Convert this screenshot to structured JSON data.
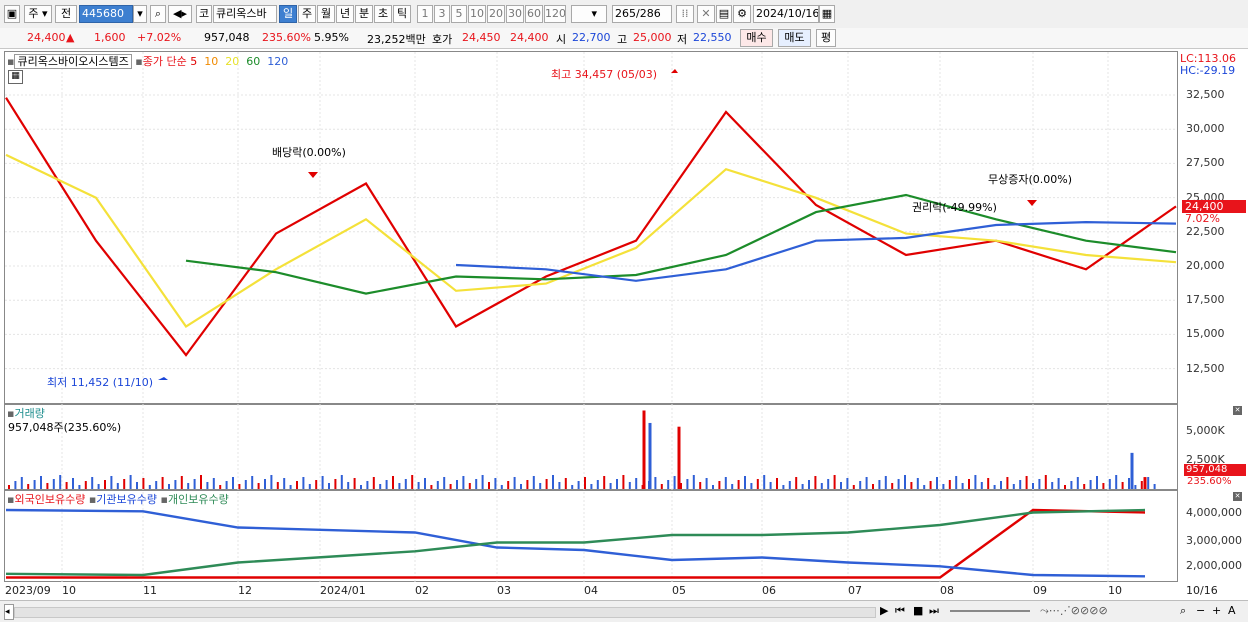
{
  "toolbar": {
    "market": "주",
    "range": "전",
    "code": "445680",
    "name_btn": "코",
    "name": "큐리옥스바",
    "periods": [
      "일",
      "주",
      "월",
      "년",
      "분",
      "초",
      "틱"
    ],
    "active_period": "일",
    "intervals": [
      "1",
      "3",
      "5",
      "10",
      "20",
      "30",
      "60",
      "120"
    ],
    "count": "265",
    "total": "/286",
    "date": "2024/10/16"
  },
  "quote": {
    "price": "24,400",
    "up_symbol": "▲",
    "change": "1,600",
    "change_pct": "+7.02%",
    "volume": "957,048",
    "volume_ratio": "235.60%",
    "turnover": "5.95%",
    "amount": "23,252백만",
    "ask_label": "호가",
    "ask_price": "24,450",
    "bid_price": "24,400",
    "open_label": "시",
    "open": "22,700",
    "high_label": "고",
    "high": "25,000",
    "low_label": "저",
    "low": "22,550",
    "buy_btn": "매수",
    "sell_btn": "매도",
    "eval_btn": "평"
  },
  "legend": {
    "stock": "큐리옥스바이오시스템즈",
    "ma_label": "종가 단순",
    "ma_periods": [
      "5",
      "10",
      "20",
      "60",
      "120"
    ],
    "ma_colors": [
      "#e00000",
      "#f08a00",
      "#e7e12a",
      "#1c8c2a",
      "#2f5fd6"
    ],
    "lc": "LC:113.06",
    "hc": "HC:-29.19"
  },
  "annotations": {
    "high": "최고 34,457 (05/03)",
    "low": "최저 11,452 (11/10)",
    "dividend": "배당락(0.00%)",
    "rights": "권리락(-49.99%)",
    "bonus": "무상증자(0.00%)"
  },
  "price_axis": [
    "32,500",
    "30,000",
    "27,500",
    "25,000",
    "22,500",
    "20,000",
    "17,500",
    "15,000",
    "12,500"
  ],
  "current_price_tag": "24,400",
  "current_pct_tag": "7.02%",
  "volume_panel": {
    "title": "거래량",
    "value": "957,048주(235.60%)",
    "axis": [
      "5,000K",
      "2,500K"
    ],
    "tag": "957,048",
    "tag_pct": "235.60%"
  },
  "holding_panel": {
    "series": [
      "외국인보유수량",
      "기관보유수량",
      "개인보유수량"
    ],
    "colors": [
      "#e00000",
      "#2f5fd6",
      "#2e8b57"
    ],
    "axis": [
      "4,000,000",
      "3,000,000",
      "2,000,000"
    ]
  },
  "x_axis": [
    "2023/09",
    "10",
    "11",
    "12",
    "2024/01",
    "02",
    "03",
    "04",
    "05",
    "06",
    "07",
    "08",
    "09",
    "10",
    "10/16"
  ],
  "chart_data": [
    {
      "type": "line",
      "title": "큐리옥스바이오시스템즈 일봉",
      "x": [
        "2023-09",
        "2023-10",
        "2023-11",
        "2023-12",
        "2024-01",
        "2024-02",
        "2024-03",
        "2024-04",
        "2024-05",
        "2024-06",
        "2024-07",
        "2024-08",
        "2024-09",
        "2024-10"
      ],
      "series": [
        {
          "name": "종가",
          "values": [
            32000,
            22000,
            14000,
            22500,
            26000,
            16000,
            19500,
            22000,
            31000,
            24500,
            21000,
            22000,
            20000,
            24400
          ]
        },
        {
          "name": "20",
          "values": [
            28000,
            25000,
            16000,
            20000,
            23500,
            18500,
            19000,
            21500,
            27000,
            25000,
            22500,
            22000,
            21000,
            20500
          ]
        },
        {
          "name": "60",
          "values": [
            null,
            null,
            20600,
            19800,
            18300,
            19500,
            19300,
            19600,
            21000,
            24000,
            25200,
            23500,
            22000,
            21200
          ]
        },
        {
          "name": "120",
          "values": [
            null,
            null,
            null,
            null,
            null,
            20300,
            20000,
            19200,
            20000,
            22000,
            22200,
            23100,
            23300,
            23200
          ]
        }
      ],
      "ylim": [
        11000,
        34500
      ],
      "annotations_points": [
        {
          "label": "최고",
          "x": "2024-05-03",
          "y": 34457
        },
        {
          "label": "최저",
          "x": "2023-11-10",
          "y": 11452
        }
      ]
    },
    {
      "type": "bar",
      "title": "거래량",
      "ylabel": "주",
      "ylim": [
        0,
        6500000
      ],
      "categories": [
        "2024-04-25",
        "2024-04-26",
        "2024-05-03",
        "2024-10-14",
        "2024-10-16"
      ],
      "values": [
        6300000,
        5300000,
        5000000,
        2900000,
        957048
      ]
    },
    {
      "type": "line",
      "title": "보유수량",
      "x": [
        "2023-09",
        "2023-11",
        "2023-12",
        "2024-02",
        "2024-03",
        "2024-04",
        "2024-05",
        "2024-06",
        "2024-07",
        "2024-08",
        "2024-09",
        "2024-10"
      ],
      "series": [
        {
          "name": "외국인보유수량",
          "values": [
            1600000,
            1600000,
            1600000,
            1600000,
            1600000,
            1600000,
            1600000,
            1600000,
            1600000,
            1600000,
            4300000,
            4200000
          ]
        },
        {
          "name": "기관보유수량",
          "values": [
            4300000,
            4250000,
            3600000,
            3400000,
            2800000,
            2700000,
            2300000,
            2400000,
            2200000,
            2050000,
            1700000,
            1650000
          ]
        },
        {
          "name": "개인보유수량",
          "values": [
            1750000,
            1700000,
            2200000,
            2650000,
            3000000,
            3000000,
            3300000,
            3300000,
            3400000,
            3700000,
            4200000,
            4300000
          ]
        }
      ],
      "ylim": [
        1500000,
        4500000
      ]
    }
  ]
}
